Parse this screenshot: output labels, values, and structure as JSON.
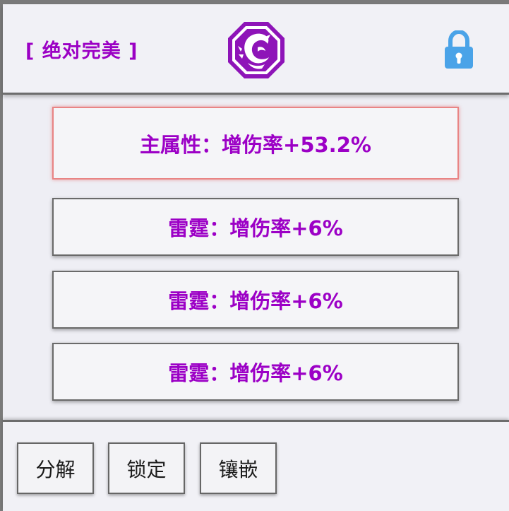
{
  "header": {
    "quality_label": "[ 绝对完美 ]",
    "emblem_icon": "dragon-octagon-emblem",
    "lock_icon": "lock-icon"
  },
  "attributes": {
    "main": "主属性：增伤率+53.2%",
    "sub": [
      "雷霆：增伤率+6%",
      "雷霆：增伤率+6%",
      "雷霆：增伤率+6%"
    ]
  },
  "buttons": {
    "decompose": "分解",
    "lock": "锁定",
    "inlay": "镶嵌"
  },
  "colors": {
    "accent_purple": "#9c00c6",
    "lock_blue": "#4aa3e8",
    "main_border": "#e98484"
  }
}
